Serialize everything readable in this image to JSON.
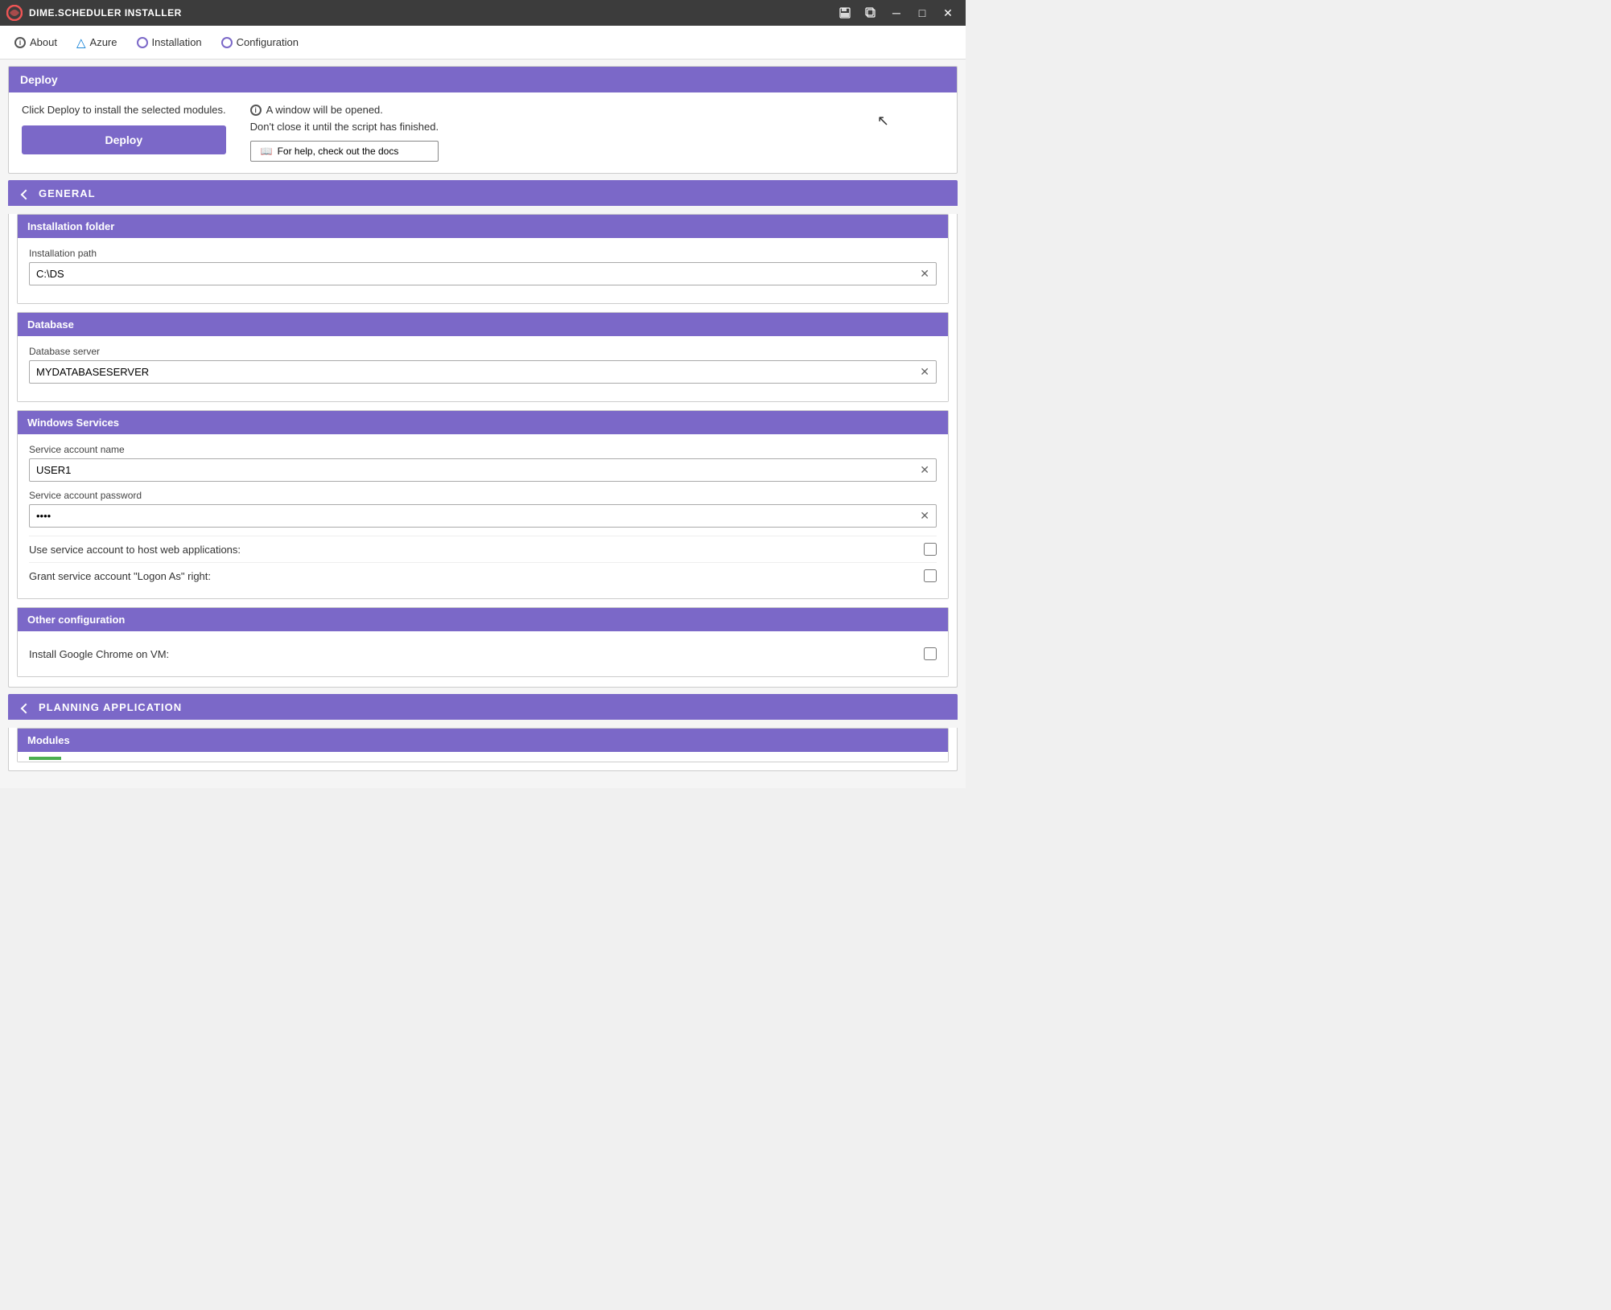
{
  "titleBar": {
    "icon": "dime-logo",
    "title": "DIME.SCHEDULER INSTALLER",
    "minimizeLabel": "─",
    "maximizeLabel": "□",
    "closeLabel": "✕"
  },
  "nav": {
    "items": [
      {
        "id": "about",
        "label": "About",
        "iconType": "info"
      },
      {
        "id": "azure",
        "label": "Azure",
        "iconType": "azure"
      },
      {
        "id": "installation",
        "label": "Installation",
        "iconType": "circle"
      },
      {
        "id": "configuration",
        "label": "Configuration",
        "iconType": "circle"
      }
    ]
  },
  "deploy": {
    "header": "Deploy",
    "instructionText": "Click Deploy to install the selected modules.",
    "buttonLabel": "Deploy",
    "infoLine1": "A window will be opened.",
    "infoLine2": "Don't close it until the script has finished.",
    "docsButtonIcon": "book-icon",
    "docsButtonLabel": "For help, check out the docs"
  },
  "general": {
    "sectionLabel": "GENERAL",
    "installationFolder": {
      "header": "Installation folder",
      "pathLabel": "Installation path",
      "pathValue": "C:\\DS"
    },
    "database": {
      "header": "Database",
      "serverLabel": "Database server",
      "serverValue": "MYDATABASESERVER"
    },
    "windowsServices": {
      "header": "Windows Services",
      "accountNameLabel": "Service account name",
      "accountNameValue": "USER1",
      "accountPasswordLabel": "Service account password",
      "accountPasswordValue": "••••",
      "useServiceAccountLabel": "Use service account to host web applications:",
      "grantLogonLabel": "Grant service account \"Logon As\" right:"
    },
    "otherConfig": {
      "header": "Other configuration",
      "installChromeLabel": "Install Google Chrome on VM:"
    }
  },
  "planningApplication": {
    "sectionLabel": "PLANNING APPLICATION",
    "modules": {
      "header": "Modules"
    }
  }
}
